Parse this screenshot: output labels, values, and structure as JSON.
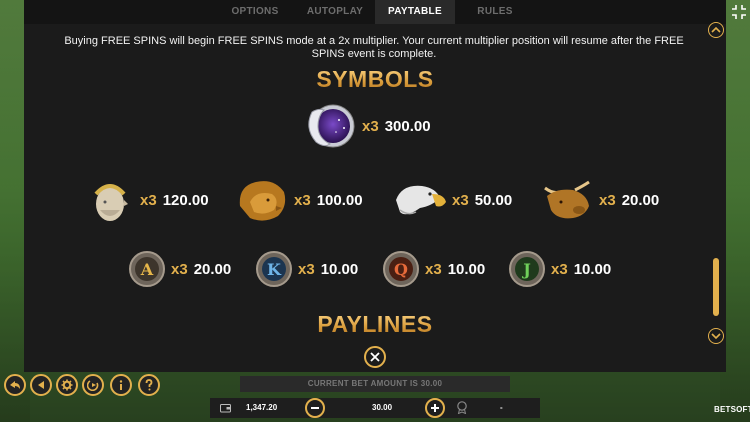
{
  "tabs": [
    {
      "label": "OPTIONS",
      "active": false
    },
    {
      "label": "AUTOPLAY",
      "active": false
    },
    {
      "label": "PAYTABLE",
      "active": true
    },
    {
      "label": "RULES",
      "active": false
    }
  ],
  "paytable": {
    "intro": "Buying FREE SPINS will begin FREE SPINS mode at a 2x multiplier. Your current multiplier position will resume after the FREE SPINS event is complete.",
    "symbols_heading": "SYMBOLS",
    "paylines_heading": "PAYLINES",
    "symbols": [
      {
        "icon": "moon-coin-icon",
        "multiplier": "x3",
        "payout": "300.00"
      },
      {
        "icon": "emperor-head-icon",
        "multiplier": "x3",
        "payout": "120.00"
      },
      {
        "icon": "lion-head-icon",
        "multiplier": "x3",
        "payout": "100.00"
      },
      {
        "icon": "eagle-head-icon",
        "multiplier": "x3",
        "payout": "50.00"
      },
      {
        "icon": "bull-head-icon",
        "multiplier": "x3",
        "payout": "20.00"
      },
      {
        "icon": "letter-a-icon",
        "letter": "A",
        "multiplier": "x3",
        "payout": "20.00"
      },
      {
        "icon": "letter-k-icon",
        "letter": "K",
        "multiplier": "x3",
        "payout": "10.00"
      },
      {
        "icon": "letter-q-icon",
        "letter": "Q",
        "multiplier": "x3",
        "payout": "10.00"
      },
      {
        "icon": "letter-j-icon",
        "letter": "J",
        "multiplier": "x3",
        "payout": "10.00"
      }
    ]
  },
  "footer": {
    "bet_banner": "CURRENT BET AMOUNT IS 30.00",
    "balance": "1,347.20",
    "bet": "30.00",
    "win": "-",
    "logo": "BETSOFT"
  },
  "colors": {
    "accent": "#e2b04d",
    "panel": "#1b1b1b"
  }
}
